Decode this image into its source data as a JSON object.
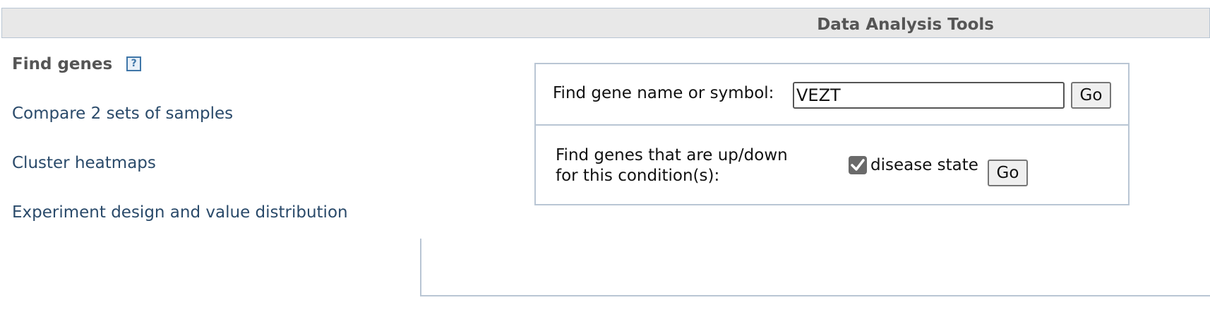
{
  "header": {
    "title": "Data Analysis Tools"
  },
  "menu": {
    "title": "Find genes",
    "help_icon": "?",
    "links": [
      "Compare 2 sets of samples",
      "Cluster heatmaps",
      "Experiment design and value distribution"
    ]
  },
  "find_gene": {
    "label": "Find gene name or symbol:",
    "value": "VEZT",
    "go_label": "Go"
  },
  "find_condition": {
    "label_line1": "Find genes that are up/down",
    "label_line2": "for this condition(s):",
    "condition_label": "disease state",
    "condition_checked": true,
    "go_label": "Go"
  }
}
